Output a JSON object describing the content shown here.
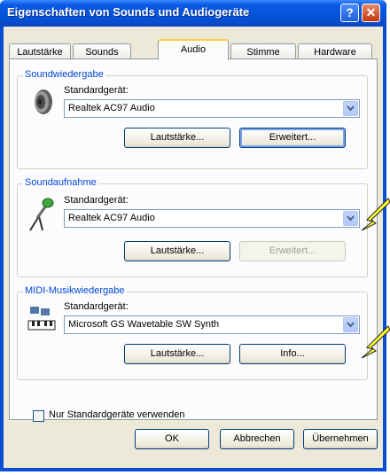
{
  "window": {
    "title": "Eigenschaften von Sounds und Audiogeräte",
    "help_glyph": "?",
    "close_glyph": "✕"
  },
  "tabs": [
    {
      "label": "Lautstärke"
    },
    {
      "label": "Sounds"
    },
    {
      "label": "Audio"
    },
    {
      "label": "Stimme"
    },
    {
      "label": "Hardware"
    }
  ],
  "active_tab": "Audio",
  "playback": {
    "title": "Soundwiedergabe",
    "device_label": "Standardgerät:",
    "device_value": "Realtek AC97 Audio",
    "volume_button": "Lautstärke...",
    "advanced_button": "Erweitert..."
  },
  "recording": {
    "title": "Soundaufnahme",
    "device_label": "Standardgerät:",
    "device_value": "Realtek AC97 Audio",
    "volume_button": "Lautstärke...",
    "advanced_button": "Erweitert..."
  },
  "midi": {
    "title": "MIDI-Musikwiedergabe",
    "device_label": "Standardgerät:",
    "device_value": "Microsoft GS Wavetable SW Synth",
    "volume_button": "Lautstärke...",
    "info_button": "Info..."
  },
  "only_default": {
    "label": "Nur Standardgeräte verwenden",
    "checked": false
  },
  "footer": {
    "ok": "OK",
    "cancel": "Abbrechen",
    "apply": "Übernehmen"
  },
  "colors": {
    "titlebar": "#0553d9",
    "group_title": "#0046d5",
    "annotation_arrow": "#ffff33",
    "active_tab_accent": "#ffc83c"
  }
}
